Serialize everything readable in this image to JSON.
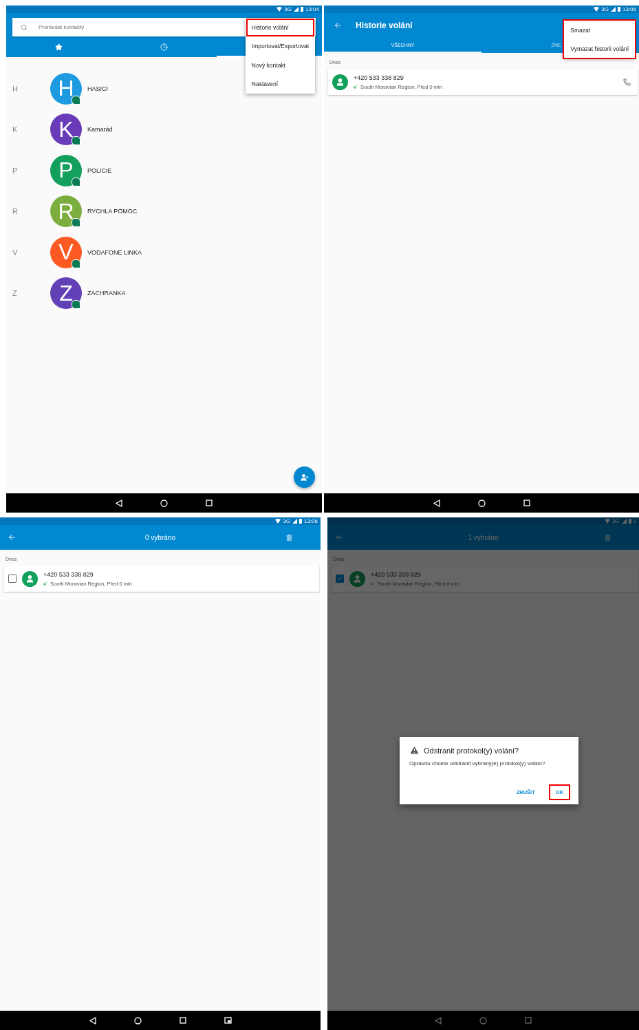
{
  "panels": [
    {
      "kind": "contacts",
      "status": {
        "network": "3G",
        "time": "13:04"
      },
      "search": {
        "placeholder": "Prohledat kontakty"
      },
      "tabs": [
        {
          "selected": false
        },
        {
          "selected": false
        },
        {
          "selected": true
        }
      ],
      "menu": {
        "highlighted": false,
        "items": [
          {
            "label": "Historie volání",
            "highlighted": true
          },
          {
            "label": "Importovat/Exportovat",
            "highlighted": false
          },
          {
            "label": "Nový kontakt",
            "highlighted": false
          },
          {
            "label": "Nastavení",
            "highlighted": false
          }
        ]
      },
      "contacts": [
        {
          "letter": "H",
          "initial": "H",
          "name": "HASICI",
          "color": "#1e9ae0"
        },
        {
          "letter": "K",
          "initial": "K",
          "name": "Kamarád",
          "color": "#6a3bb8"
        },
        {
          "letter": "P",
          "initial": "P",
          "name": "POLICIE",
          "color": "#12a05c"
        },
        {
          "letter": "R",
          "initial": "R",
          "name": "RYCHLA POMOC",
          "color": "#7cae3f"
        },
        {
          "letter": "V",
          "initial": "V",
          "name": "VODAFONE LINKA",
          "color": "#fb5a22"
        },
        {
          "letter": "Z",
          "initial": "Z",
          "name": "ZACHRANKA",
          "color": "#6240b5"
        }
      ]
    },
    {
      "kind": "call_log",
      "status": {
        "network": "3G",
        "time": "13:06"
      },
      "title": "Historie volání",
      "tabs": [
        {
          "label": "VŠECHNY",
          "selected": true
        },
        {
          "label": "ZME",
          "selected": false
        }
      ],
      "menu": {
        "highlighted": true,
        "items": [
          {
            "label": "Smazat",
            "highlighted": false
          },
          {
            "label": "Vymazat historii volání",
            "highlighted": false
          }
        ]
      },
      "section": "Dnes",
      "entry": {
        "number": "+420 533 338 829",
        "detail": "South Moravian Region, Před 0 min"
      }
    },
    {
      "kind": "select",
      "status": {
        "network": "3G",
        "time": "13:06"
      },
      "title": "0 vybráno",
      "dimmed": false,
      "section": "Dnes",
      "entry": {
        "number": "+420 533 338 829",
        "detail": "South Moravian Region, Před 0 min",
        "checked": false
      }
    },
    {
      "kind": "select",
      "status": {
        "network": "3G",
        "time": "1"
      },
      "title": "1 vybráno",
      "dimmed": true,
      "section": "Dnes",
      "entry": {
        "number": "+420 533 338 829",
        "detail": "South Moravian Region, Před 0 min",
        "checked": true
      },
      "dialog": {
        "title": "Odstranit protokol(y) volání?",
        "message": "Opravdu chcete odstranit vybraný(é) protokol(y) volání?",
        "buttons": [
          {
            "label": "ZRUŠIT",
            "highlighted": false
          },
          {
            "label": "OK",
            "highlighted": true
          }
        ]
      }
    }
  ]
}
